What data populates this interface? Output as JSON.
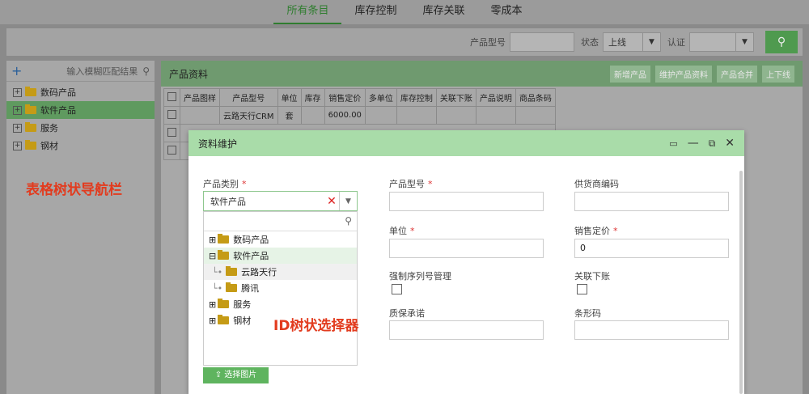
{
  "top_tabs": [
    {
      "label": "所有条目",
      "active": true
    },
    {
      "label": "库存控制",
      "active": false
    },
    {
      "label": "库存关联",
      "active": false
    },
    {
      "label": "零成本",
      "active": false
    }
  ],
  "filter": {
    "model_label": "产品型号",
    "status_label": "状态",
    "status_value": "上线",
    "cert_label": "认证",
    "search_icon": "search-icon"
  },
  "left_tree": {
    "add_label": "+",
    "search_placeholder": "输入模糊匹配结果",
    "items": [
      {
        "label": "数码产品",
        "selected": false
      },
      {
        "label": "软件产品",
        "selected": true
      },
      {
        "label": "服务",
        "selected": false
      },
      {
        "label": "钢材",
        "selected": false
      }
    ]
  },
  "annotations": {
    "tree_nav": "表格树状导航栏",
    "id_tree": "ID树状选择器"
  },
  "product_panel": {
    "title": "产品资料",
    "buttons": [
      "新增产品",
      "维护产品资料",
      "产品合并",
      "上下线"
    ],
    "columns": [
      "产品图样",
      "产品型号",
      "单位",
      "库存",
      "销售定价",
      "多单位",
      "库存控制",
      "关联下账",
      "产品说明",
      "商品条码"
    ],
    "rows": [
      {
        "model": "云路天行CRM",
        "unit": "套",
        "price": "6000.00"
      }
    ]
  },
  "modal": {
    "title": "资料维护",
    "fields": {
      "category_label": "产品类别",
      "category_value": "软件产品",
      "model_label": "产品型号",
      "supplier_code_label": "供货商编码",
      "unit_label": "单位",
      "price_label": "销售定价",
      "price_value": "0",
      "serial_label": "强制序列号管理",
      "link_label": "关联下账",
      "warranty_label": "质保承诺",
      "barcode_label": "条形码",
      "upload_label": "选择图片"
    },
    "dropdown_tree": [
      {
        "label": "数码产品",
        "level": 0,
        "expander": "⊞"
      },
      {
        "label": "软件产品",
        "level": 0,
        "expander": "⊟"
      },
      {
        "label": "云路天行",
        "level": 1,
        "expander": ""
      },
      {
        "label": "腾讯",
        "level": 1,
        "expander": ""
      },
      {
        "label": "服务",
        "level": 0,
        "expander": "⊞"
      },
      {
        "label": "钢材",
        "level": 0,
        "expander": "⊞"
      }
    ]
  }
}
